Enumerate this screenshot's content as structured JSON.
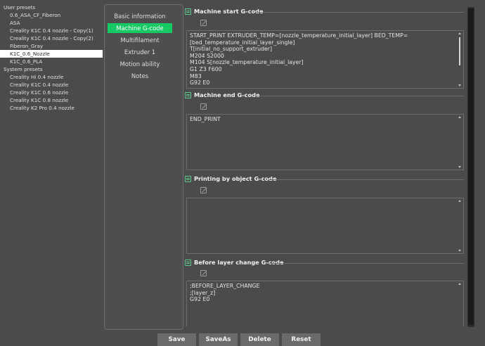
{
  "presets": {
    "user_title": "User presets",
    "user_items": [
      "0.6_ASA_CF_Fiberon",
      "ASA",
      "Creality K1C 0.4 nozzle - Copy(1)",
      "Creality K1C 0.4 nozzle - Copy(2)",
      "Fiberon_Gray",
      "K1C_0.6_Nozzle",
      "K1C_0.6_PLA"
    ],
    "selected": "K1C_0.6_Nozzle",
    "system_title": "System presets",
    "system_items": [
      "Creality Hi 0.4 nozzle",
      "Creality K1C 0.4 nozzle",
      "Creality K1C 0.6 nozzle",
      "Creality K1C 0.8 nozzle",
      "Creality K2 Pro 0.4 nozzle"
    ]
  },
  "nav": {
    "items": [
      "Basic information",
      "Machine G-code",
      "Multifilament",
      "Extruder 1",
      "Motion ability",
      "Notes"
    ],
    "active": "Machine G-code"
  },
  "sections": [
    {
      "title": "Machine start G-code",
      "content": "START_PRINT EXTRUDER_TEMP=[nozzle_temperature_initial_layer] BED_TEMP=[bed_temperature_initial_layer_single]\nT[initial_no_support_extruder]\nM204 S2000\nM104 S[nozzle_temperature_initial_layer]\nG1 Z3 F600\nM83\nG92 E0"
    },
    {
      "title": "Machine end G-code",
      "content": "END_PRINT"
    },
    {
      "title": "Printing by object G-code",
      "content": ""
    },
    {
      "title": "Before layer change G-code",
      "content": ";BEFORE_LAYER_CHANGE\n;[layer_z]\nG92 E0"
    }
  ],
  "buttons": {
    "save": "Save",
    "save_as": "SaveAs",
    "delete": "Delete",
    "reset": "Reset"
  },
  "colors": {
    "accent": "#17c964",
    "background": "#4b4b4d",
    "selected_bg": "#ffffff"
  }
}
